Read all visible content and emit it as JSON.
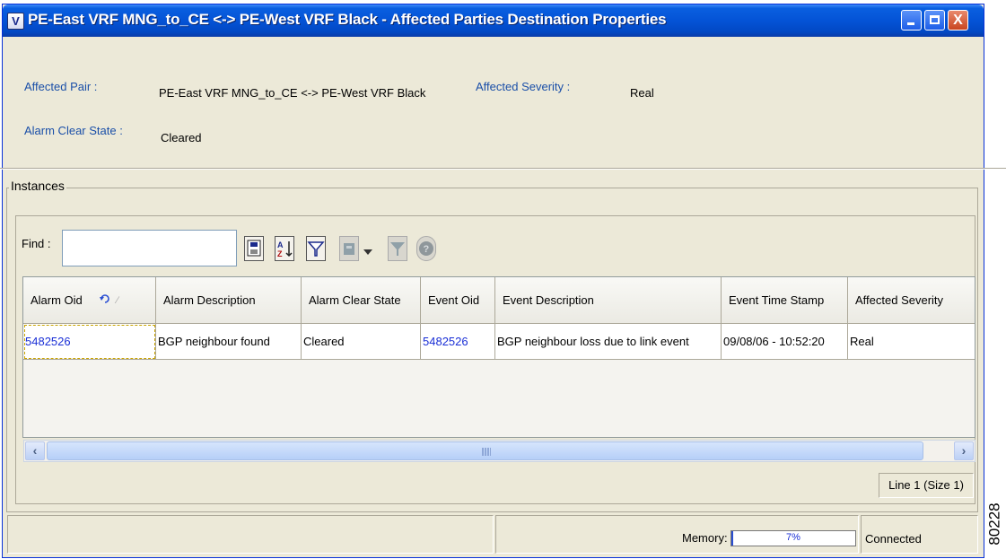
{
  "window": {
    "title": "PE-East VRF MNG_to_CE <-> PE-West VRF Black - Affected Parties Destination Properties",
    "app_icon_letter": "V",
    "close_glyph": "X"
  },
  "properties": {
    "affected_pair_label": "Affected Pair :",
    "affected_pair_value": "PE-East VRF MNG_to_CE <-> PE-West VRF Black",
    "affected_severity_label": "Affected Severity :",
    "affected_severity_value": "Real",
    "alarm_clear_state_label": "Alarm Clear State :",
    "alarm_clear_state_value": "Cleared"
  },
  "instances": {
    "group_title": "Instances",
    "find_label": "Find :",
    "find_value": "",
    "toolbar_icons": [
      "save-icon",
      "sort-az-icon",
      "filter-icon",
      "export-icon",
      "dropdown-arrow-icon",
      "clear-filter-icon",
      "help-icon"
    ],
    "columns": [
      "Alarm Oid",
      "Alarm Description",
      "Alarm Clear State",
      "Event Oid",
      "Event Description",
      "Event Time Stamp",
      "Affected Severity"
    ],
    "rows": [
      [
        "5482526",
        "BGP neighbour found",
        "Cleared",
        "5482526",
        "BGP neighbour loss due to link event",
        "09/08/06 - 10:52:20",
        "Real"
      ]
    ],
    "line_info": "Line 1 (Size 1)"
  },
  "status_bar": {
    "memory_label": "Memory:",
    "memory_percent": 7,
    "memory_text": "7%",
    "connection": "Connected"
  },
  "watermark": "80228",
  "colors": {
    "title_bar": "#0453d6",
    "label_blue": "#1a4fa8",
    "link_blue": "#1a2fd6",
    "window_bg": "#ece9d8"
  }
}
